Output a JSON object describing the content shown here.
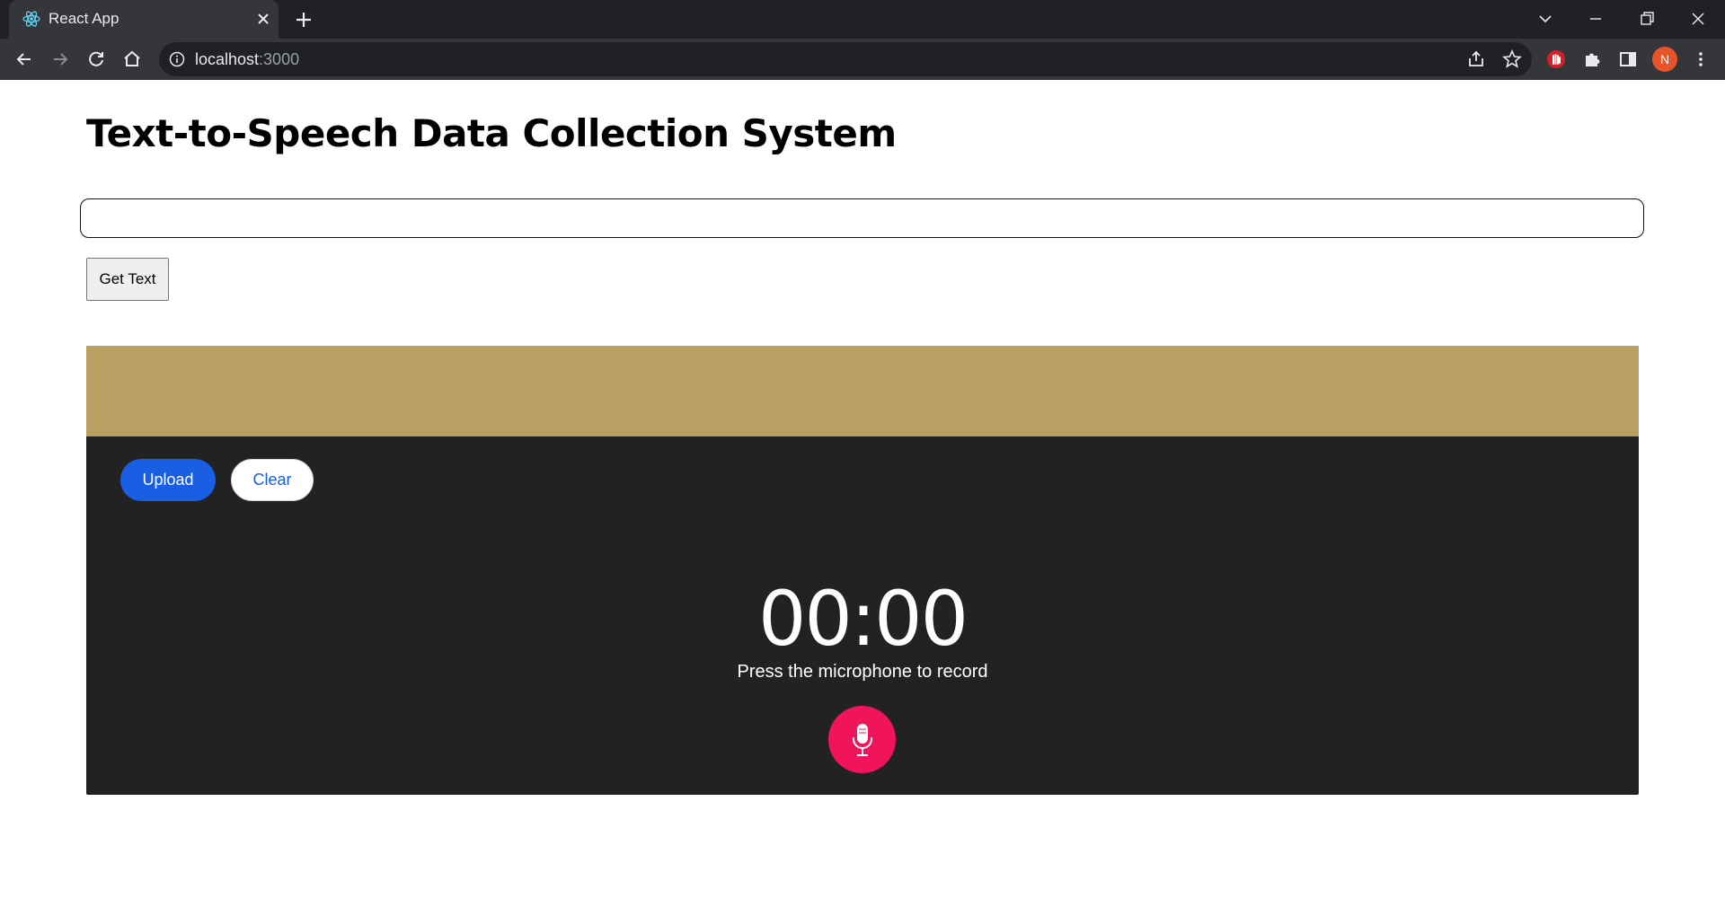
{
  "browser": {
    "tab_title": "React App",
    "url_host": "localhost",
    "url_port": ":3000",
    "profile_initial": "N"
  },
  "page": {
    "title": "Text-to-Speech Data Collection System",
    "text_input_value": "",
    "get_text_label": "Get Text"
  },
  "recorder": {
    "upload_label": "Upload",
    "clear_label": "Clear",
    "timer": "00:00",
    "hint": "Press the microphone to record",
    "colors": {
      "header": "#bb9e62",
      "panel": "#222223",
      "upload": "#1a5fe3",
      "mic": "#f0145a"
    }
  }
}
